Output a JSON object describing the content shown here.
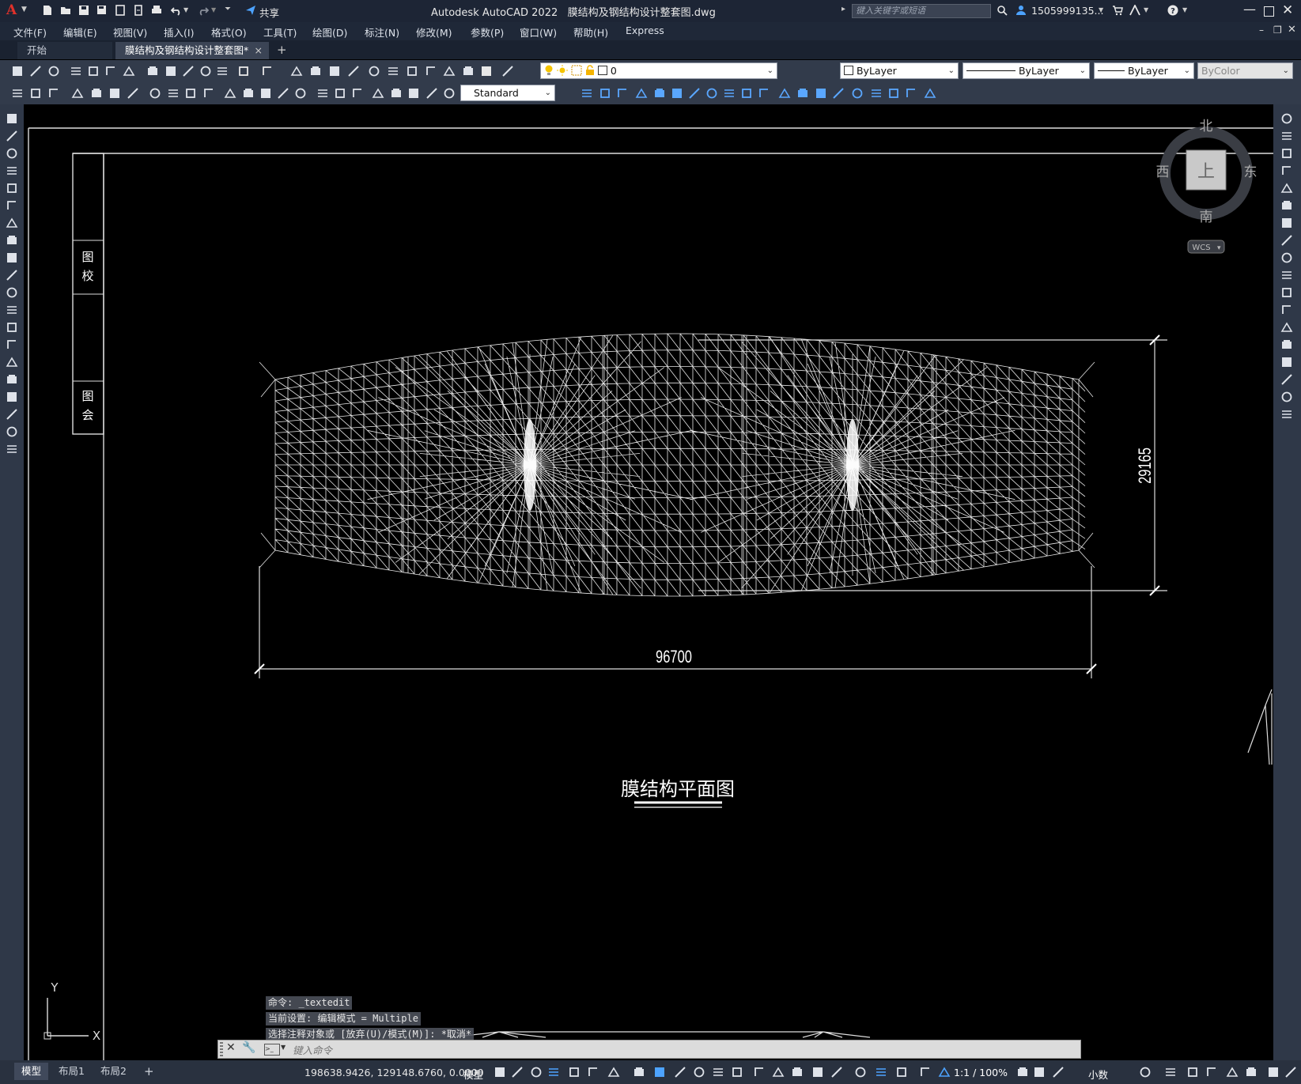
{
  "titlebar": {
    "app_title": "Autodesk AutoCAD 2022",
    "file_name": "膜结构及钢结构设计整套图.dwg",
    "search_placeholder": "键入关键字或短语",
    "user": "1505999135...",
    "share_label": "共享"
  },
  "menu": [
    "文件(F)",
    "编辑(E)",
    "视图(V)",
    "插入(I)",
    "格式(O)",
    "工具(T)",
    "绘图(D)",
    "标注(N)",
    "修改(M)",
    "参数(P)",
    "窗口(W)",
    "帮助(H)",
    "Express"
  ],
  "tabs": {
    "start": "开始",
    "active": "膜结构及钢结构设计整套图*",
    "close": "×",
    "add": "+"
  },
  "toolbar": {
    "layer_value": "0",
    "color": "ByLayer",
    "linetype": "ByLayer",
    "lineweight": "ByLayer",
    "plotstyle": "ByColor",
    "text_style": "Standard"
  },
  "viewcube": {
    "north": "北",
    "south": "南",
    "east": "东",
    "west": "西",
    "top": "上",
    "wcs": "WCS"
  },
  "drawing": {
    "dim_width": "96700",
    "dim_height": "29165",
    "title": "膜结构平面图",
    "titleblock_upper": [
      "图",
      "校"
    ],
    "titleblock_lower": [
      "图",
      "会"
    ]
  },
  "ucs": {
    "x": "X",
    "y": "Y"
  },
  "command": {
    "history": [
      "命令: _textedit",
      "当前设置: 编辑模式 = Multiple",
      "选择注释对象或 [放弃(U)/模式(M)]: *取消*"
    ],
    "placeholder": "键入命令"
  },
  "layout_tabs": [
    "模型",
    "布局1",
    "布局2",
    "+"
  ],
  "status": {
    "coordinates": "198638.9426, 129148.6760, 0.0000",
    "model": "模型",
    "scale": "1:1 / 100%",
    "units": "小数"
  }
}
